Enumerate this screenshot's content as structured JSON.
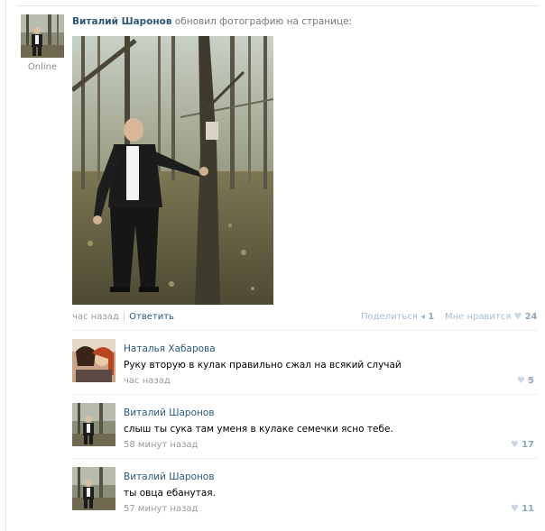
{
  "post": {
    "author": "Виталий Шаронов",
    "action": "обновил фотографию на странице:",
    "status": "Online",
    "time": "час назад",
    "reply_label": "Ответить",
    "share_label": "Поделиться",
    "share_count": "1",
    "like_label": "Мне нравится",
    "like_count": "24"
  },
  "icons": {
    "heart": "heart-icon",
    "share": "megaphone-icon"
  },
  "comments": [
    {
      "name": "Наталья Хабарова",
      "text": "Руку вторую в кулак правильно сжал на всякий случай",
      "time": "час назад",
      "likes": "5"
    },
    {
      "name": "Виталий Шаронов",
      "text": "слыш ты сука там уменя в кулаке семечки ясно тебе.",
      "time": "58 минут назад",
      "likes": "17"
    },
    {
      "name": "Виталий Шаронов",
      "text": "ты овца ебанутая.",
      "time": "57 минут назад",
      "likes": "11"
    }
  ]
}
